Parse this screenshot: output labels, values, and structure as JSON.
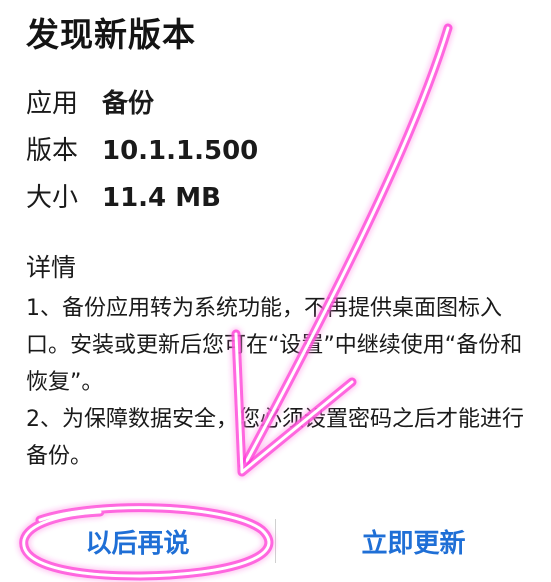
{
  "dialog": {
    "title": "发现新版本",
    "rows": [
      {
        "label": "应用",
        "value": "备份"
      },
      {
        "label": "版本",
        "value": "10.1.1.500"
      },
      {
        "label": "大小",
        "value": "11.4 MB"
      }
    ],
    "details": {
      "heading": "详情",
      "item1": "1、备份应用转为系统功能，不再提供桌面图标入口。安装或更新后您可在“设置”中继续使用“备份和恢复”。",
      "item2": "2、为保障数据安全，您必须设置密码之后才能进行备份。"
    },
    "buttons": {
      "later": "以后再说",
      "update_now": "立即更新"
    },
    "colors": {
      "button_text": "#1f6fd6",
      "annotation": "#ff2fd8"
    }
  }
}
